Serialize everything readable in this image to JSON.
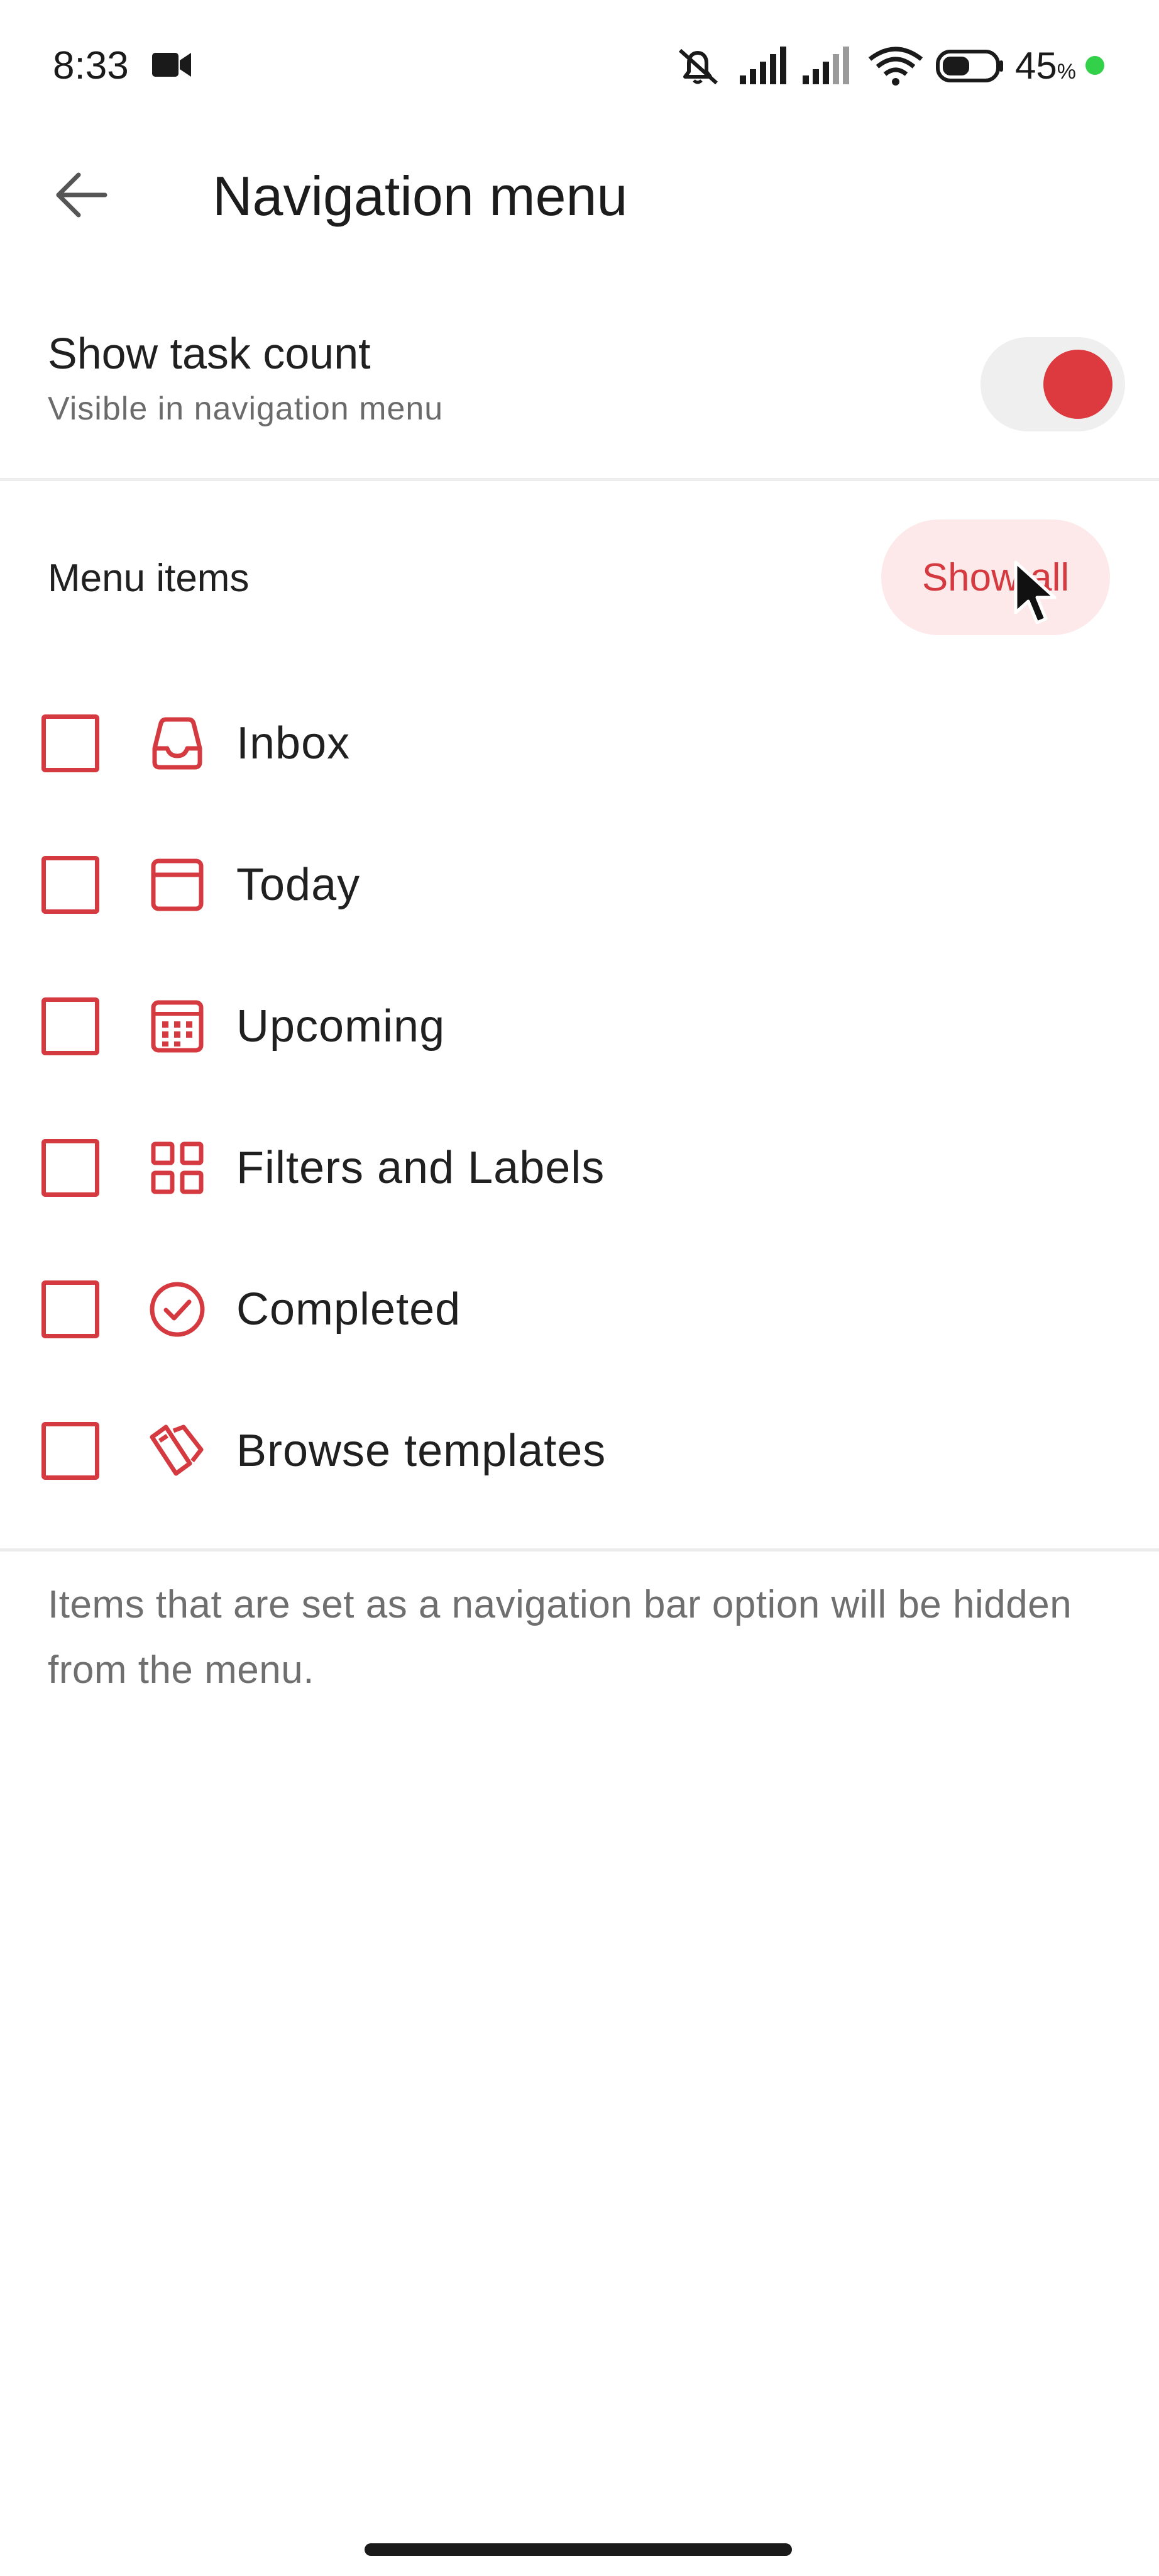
{
  "status_bar": {
    "time": "8:33",
    "battery_level": "45",
    "battery_unit": "%"
  },
  "app_bar": {
    "title": "Navigation menu"
  },
  "task_count": {
    "title": "Show task count",
    "subtitle": "Visible in navigation menu",
    "enabled": true
  },
  "menu_section": {
    "header": "Menu items",
    "show_all_label": "Show all",
    "items": [
      {
        "label": "Inbox",
        "icon": "inbox-icon",
        "checked": false
      },
      {
        "label": "Today",
        "icon": "today-icon",
        "checked": false
      },
      {
        "label": "Upcoming",
        "icon": "calendar-icon",
        "checked": false
      },
      {
        "label": "Filters and Labels",
        "icon": "grid-icon",
        "checked": false
      },
      {
        "label": "Completed",
        "icon": "check-circle-icon",
        "checked": false
      },
      {
        "label": "Browse templates",
        "icon": "templates-icon",
        "checked": false
      }
    ]
  },
  "footer_note": "Items that are set as a navigation bar option will be hidden from the menu.",
  "colors": {
    "accent": "#d53a40",
    "accent_soft": "#fde9ea",
    "text_primary": "#202020",
    "text_secondary": "#6b6b6b",
    "divider": "#ececec"
  }
}
